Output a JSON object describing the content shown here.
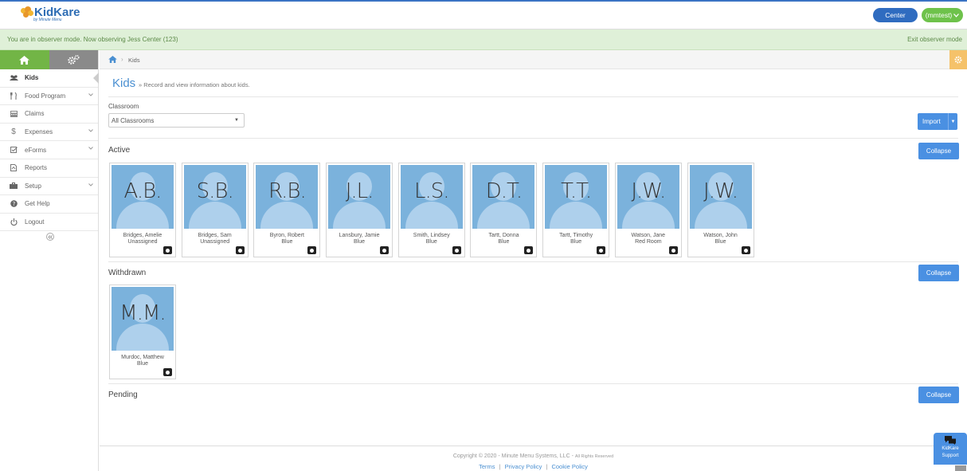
{
  "header": {
    "logo_text": "KidKare",
    "logo_sub": "by Minute Menu",
    "center_label": "Center",
    "user_label": "(mmtest)"
  },
  "observer": {
    "message": "You are in observer mode. Now observing Jess Center (123)",
    "exit_label": "Exit observer mode"
  },
  "sidebar": {
    "items": [
      {
        "label": "Kids",
        "icon": "users-icon"
      },
      {
        "label": "Food Program",
        "icon": "utensils-icon"
      },
      {
        "label": "Claims",
        "icon": "calculator-icon"
      },
      {
        "label": "Expenses",
        "icon": "dollar-icon"
      },
      {
        "label": "eForms",
        "icon": "checkbox-icon"
      },
      {
        "label": "Reports",
        "icon": "report-icon"
      },
      {
        "label": "Setup",
        "icon": "briefcase-icon"
      },
      {
        "label": "Get Help",
        "icon": "help-icon"
      },
      {
        "label": "Logout",
        "icon": "power-icon"
      }
    ]
  },
  "breadcrumb": {
    "current": "Kids"
  },
  "page": {
    "title": "Kids",
    "subtitle": "» Record and view information about kids.",
    "classroom_label": "Classroom",
    "classroom_value": "All Classrooms",
    "import_label": "Import"
  },
  "sections": {
    "active": {
      "title": "Active",
      "collapse_label": "Collapse",
      "kids": [
        {
          "initials": "A.B.",
          "name": "Bridges, Amelie",
          "room": "Unassigned"
        },
        {
          "initials": "S.B.",
          "name": "Bridges, Sam",
          "room": "Unassigned"
        },
        {
          "initials": "R.B.",
          "name": "Byron, Robert",
          "room": "Blue"
        },
        {
          "initials": "J.L.",
          "name": "Lansbury, Jamie",
          "room": "Blue"
        },
        {
          "initials": "L.S.",
          "name": "Smith, Lindsey",
          "room": "Blue"
        },
        {
          "initials": "D.T.",
          "name": "Tartt, Donna",
          "room": "Blue"
        },
        {
          "initials": "T.T.",
          "name": "Tartt, Timothy",
          "room": "Blue"
        },
        {
          "initials": "J.W.",
          "name": "Watson, Jane",
          "room": "Red Room"
        },
        {
          "initials": "J.W.",
          "name": "Watson, John",
          "room": "Blue"
        }
      ]
    },
    "withdrawn": {
      "title": "Withdrawn",
      "collapse_label": "Collapse",
      "kids": [
        {
          "initials": "M.M.",
          "name": "Murdoc, Matthew",
          "room": "Blue"
        }
      ]
    },
    "pending": {
      "title": "Pending",
      "collapse_label": "Collapse"
    }
  },
  "footer": {
    "copyright": "Copyright © 2020 - Minute Menu Systems, LLC - ",
    "rights": "All Rights Reserved",
    "terms": "Terms",
    "privacy": "Privacy Policy",
    "cookie": "Cookie Policy",
    "link_sep": "|"
  },
  "support": {
    "line1": "KidKare",
    "line2": "Support"
  },
  "colors": {
    "primary_blue": "#4a90e2",
    "header_blue": "#2f6cc0",
    "green": "#6ec24b",
    "observer_bg": "#dff0d8",
    "photo_bg": "#7bb2dc"
  }
}
